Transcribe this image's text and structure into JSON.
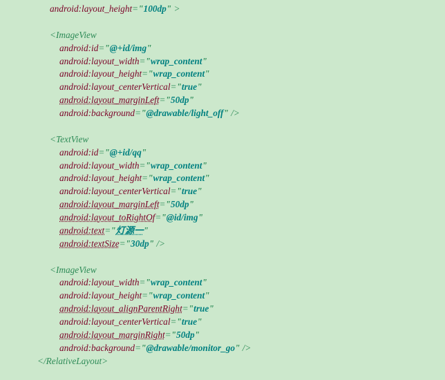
{
  "lines": [
    {
      "cls": "ind1",
      "parts": [
        {
          "t": "attr",
          "v": "android:layout_height"
        },
        {
          "t": "punc",
          "v": "="
        },
        {
          "t": "quote",
          "v": "\""
        },
        {
          "t": "val",
          "v": "100dp"
        },
        {
          "t": "quote",
          "v": "\""
        },
        {
          "t": "elem",
          "v": " >"
        }
      ]
    },
    {
      "cls": "blank"
    },
    {
      "cls": "ind1",
      "parts": [
        {
          "t": "elem",
          "v": "<ImageView"
        }
      ]
    },
    {
      "cls": "ind2",
      "parts": [
        {
          "t": "attr",
          "v": "android:id"
        },
        {
          "t": "punc",
          "v": "="
        },
        {
          "t": "quote",
          "v": "\""
        },
        {
          "t": "val",
          "v": "@+id/img"
        },
        {
          "t": "quote",
          "v": "\""
        }
      ]
    },
    {
      "cls": "ind2",
      "parts": [
        {
          "t": "attr",
          "v": "android:layout_width"
        },
        {
          "t": "punc",
          "v": "="
        },
        {
          "t": "quote",
          "v": "\""
        },
        {
          "t": "val",
          "v": "wrap_content"
        },
        {
          "t": "quote",
          "v": "\""
        }
      ]
    },
    {
      "cls": "ind2",
      "parts": [
        {
          "t": "attr",
          "v": "android:layout_height"
        },
        {
          "t": "punc",
          "v": "="
        },
        {
          "t": "quote",
          "v": "\""
        },
        {
          "t": "val",
          "v": "wrap_content"
        },
        {
          "t": "quote",
          "v": "\""
        }
      ]
    },
    {
      "cls": "ind2",
      "parts": [
        {
          "t": "attr",
          "v": "android:layout_centerVertical"
        },
        {
          "t": "punc",
          "v": "="
        },
        {
          "t": "quote",
          "v": "\""
        },
        {
          "t": "val",
          "v": "true"
        },
        {
          "t": "quote",
          "v": "\""
        }
      ]
    },
    {
      "cls": "ind2",
      "parts": [
        {
          "t": "attr-u",
          "v": "android:layout_marginLeft"
        },
        {
          "t": "punc",
          "v": "="
        },
        {
          "t": "quote",
          "v": "\""
        },
        {
          "t": "val",
          "v": "50dp"
        },
        {
          "t": "quote",
          "v": "\""
        }
      ]
    },
    {
      "cls": "ind2",
      "parts": [
        {
          "t": "attr",
          "v": "android:background"
        },
        {
          "t": "punc",
          "v": "="
        },
        {
          "t": "quote",
          "v": "\""
        },
        {
          "t": "val",
          "v": "@drawable/light_off"
        },
        {
          "t": "quote",
          "v": "\""
        },
        {
          "t": "elem",
          "v": " />"
        }
      ]
    },
    {
      "cls": "blank"
    },
    {
      "cls": "ind1",
      "parts": [
        {
          "t": "elem",
          "v": "<TextView"
        }
      ]
    },
    {
      "cls": "ind2",
      "parts": [
        {
          "t": "attr",
          "v": "android:id"
        },
        {
          "t": "punc",
          "v": "="
        },
        {
          "t": "quote",
          "v": "\""
        },
        {
          "t": "val",
          "v": "@+id/qq"
        },
        {
          "t": "quote",
          "v": "\""
        }
      ]
    },
    {
      "cls": "ind2",
      "parts": [
        {
          "t": "attr",
          "v": "android:layout_width"
        },
        {
          "t": "punc",
          "v": "="
        },
        {
          "t": "quote",
          "v": "\""
        },
        {
          "t": "val",
          "v": "wrap_content"
        },
        {
          "t": "quote",
          "v": "\""
        }
      ]
    },
    {
      "cls": "ind2",
      "parts": [
        {
          "t": "attr",
          "v": "android:layout_height"
        },
        {
          "t": "punc",
          "v": "="
        },
        {
          "t": "quote",
          "v": "\""
        },
        {
          "t": "val",
          "v": "wrap_content"
        },
        {
          "t": "quote",
          "v": "\""
        }
      ]
    },
    {
      "cls": "ind2",
      "parts": [
        {
          "t": "attr",
          "v": "android:layout_centerVertical"
        },
        {
          "t": "punc",
          "v": "="
        },
        {
          "t": "quote",
          "v": "\""
        },
        {
          "t": "val",
          "v": "true"
        },
        {
          "t": "quote",
          "v": "\""
        }
      ]
    },
    {
      "cls": "ind2",
      "parts": [
        {
          "t": "attr-u",
          "v": "android:layout_marginLeft"
        },
        {
          "t": "punc",
          "v": "="
        },
        {
          "t": "quote",
          "v": "\""
        },
        {
          "t": "val",
          "v": "50dp"
        },
        {
          "t": "quote",
          "v": "\""
        }
      ]
    },
    {
      "cls": "ind2",
      "parts": [
        {
          "t": "attr-u",
          "v": "android:layout_toRightOf"
        },
        {
          "t": "punc",
          "v": "="
        },
        {
          "t": "quote",
          "v": "\""
        },
        {
          "t": "val",
          "v": "@id/img"
        },
        {
          "t": "quote",
          "v": "\""
        }
      ]
    },
    {
      "cls": "ind2",
      "parts": [
        {
          "t": "attr-u",
          "v": "android:text"
        },
        {
          "t": "punc",
          "v": "="
        },
        {
          "t": "quote",
          "v": "\""
        },
        {
          "t": "val-u",
          "v": "灯源一"
        },
        {
          "t": "quote",
          "v": "\""
        }
      ]
    },
    {
      "cls": "ind2",
      "parts": [
        {
          "t": "attr-u",
          "v": "android:textSize"
        },
        {
          "t": "punc",
          "v": "="
        },
        {
          "t": "quote",
          "v": "\""
        },
        {
          "t": "val",
          "v": "30dp"
        },
        {
          "t": "quote",
          "v": "\""
        },
        {
          "t": "elem",
          "v": " />"
        }
      ]
    },
    {
      "cls": "blank"
    },
    {
      "cls": "ind1",
      "parts": [
        {
          "t": "elem",
          "v": "<ImageView"
        }
      ]
    },
    {
      "cls": "ind2",
      "parts": [
        {
          "t": "attr",
          "v": "android:layout_width"
        },
        {
          "t": "punc",
          "v": "="
        },
        {
          "t": "quote",
          "v": "\""
        },
        {
          "t": "val",
          "v": "wrap_content"
        },
        {
          "t": "quote",
          "v": "\""
        }
      ]
    },
    {
      "cls": "ind2",
      "parts": [
        {
          "t": "attr",
          "v": "android:layout_height"
        },
        {
          "t": "punc",
          "v": "="
        },
        {
          "t": "quote",
          "v": "\""
        },
        {
          "t": "val",
          "v": "wrap_content"
        },
        {
          "t": "quote",
          "v": "\""
        }
      ]
    },
    {
      "cls": "ind2",
      "parts": [
        {
          "t": "attr-u",
          "v": "android:layout_alignParentRight"
        },
        {
          "t": "punc",
          "v": "="
        },
        {
          "t": "quote",
          "v": "\""
        },
        {
          "t": "val",
          "v": "true"
        },
        {
          "t": "quote",
          "v": "\""
        }
      ]
    },
    {
      "cls": "ind2",
      "parts": [
        {
          "t": "attr",
          "v": "android:layout_centerVertical"
        },
        {
          "t": "punc",
          "v": "="
        },
        {
          "t": "quote",
          "v": "\""
        },
        {
          "t": "val",
          "v": "true"
        },
        {
          "t": "quote",
          "v": "\""
        }
      ]
    },
    {
      "cls": "ind2",
      "parts": [
        {
          "t": "attr-u",
          "v": "android:layout_marginRight"
        },
        {
          "t": "punc",
          "v": "="
        },
        {
          "t": "quote",
          "v": "\""
        },
        {
          "t": "val",
          "v": "50dp"
        },
        {
          "t": "quote",
          "v": "\""
        }
      ]
    },
    {
      "cls": "ind2",
      "parts": [
        {
          "t": "attr",
          "v": "android:background"
        },
        {
          "t": "punc",
          "v": "="
        },
        {
          "t": "quote",
          "v": "\""
        },
        {
          "t": "val",
          "v": "@drawable/monitor_go"
        },
        {
          "t": "quote",
          "v": "\""
        },
        {
          "t": "elem",
          "v": " />"
        }
      ]
    },
    {
      "cls": "ind3",
      "parts": [
        {
          "t": "elem",
          "v": "</RelativeLayout>"
        }
      ]
    }
  ]
}
